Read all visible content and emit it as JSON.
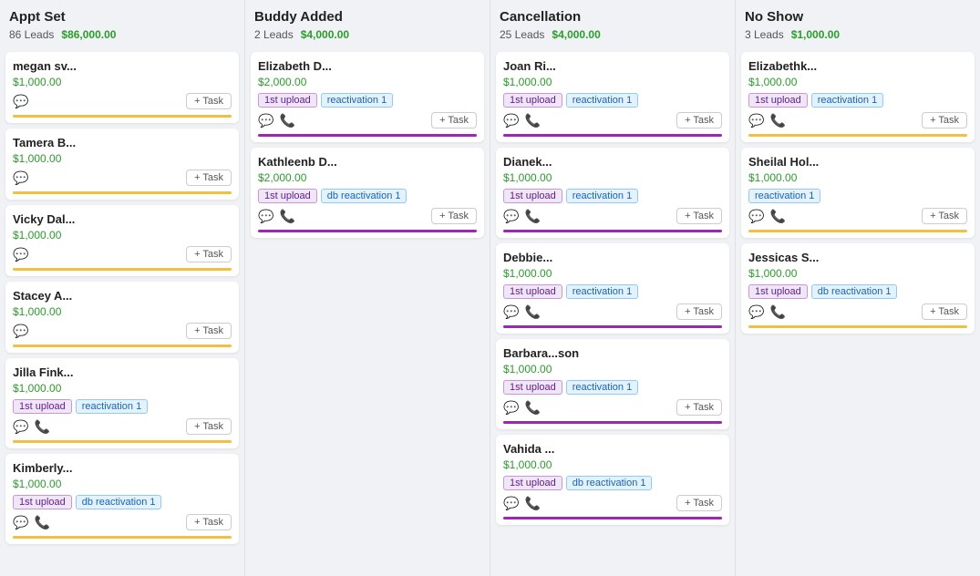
{
  "columns": [
    {
      "id": "appt-set",
      "title": "Appt Set",
      "leads": "86 Leads",
      "amount": "$86,000.00",
      "cards": [
        {
          "name": "megan sv...",
          "amount": "$1,000.00",
          "tags": [],
          "showPhone": false,
          "divider": "gold"
        },
        {
          "name": "Tamera B...",
          "amount": "$1,000.00",
          "tags": [],
          "showPhone": false,
          "divider": "gold"
        },
        {
          "name": "Vicky Dal...",
          "amount": "$1,000.00",
          "tags": [],
          "showPhone": false,
          "divider": "gold"
        },
        {
          "name": "Stacey A...",
          "amount": "$1,000.00",
          "tags": [],
          "showPhone": false,
          "divider": "gold"
        },
        {
          "name": "Jilla Fink...",
          "amount": "$1,000.00",
          "tags": [
            {
              "text": "1st upload",
              "type": "purple"
            },
            {
              "text": "reactivation 1",
              "type": "blue"
            }
          ],
          "showPhone": true,
          "divider": "gold"
        },
        {
          "name": "Kimberly...",
          "amount": "$1,000.00",
          "tags": [
            {
              "text": "1st upload",
              "type": "purple"
            },
            {
              "text": "db reactivation 1",
              "type": "blue"
            }
          ],
          "showPhone": true,
          "divider": "gold"
        }
      ]
    },
    {
      "id": "buddy-added",
      "title": "Buddy Added",
      "leads": "2 Leads",
      "amount": "$4,000.00",
      "cards": [
        {
          "name": "Elizabeth D...",
          "amount": "$2,000.00",
          "tags": [
            {
              "text": "1st upload",
              "type": "purple"
            },
            {
              "text": "reactivation 1",
              "type": "blue"
            }
          ],
          "showPhone": true,
          "divider": "purple"
        },
        {
          "name": "Kathleenb D...",
          "amount": "$2,000.00",
          "tags": [
            {
              "text": "1st upload",
              "type": "purple"
            },
            {
              "text": "db reactivation 1",
              "type": "blue"
            }
          ],
          "showPhone": true,
          "divider": "purple"
        }
      ]
    },
    {
      "id": "cancellation",
      "title": "Cancellation",
      "leads": "25 Leads",
      "amount": "$4,000.00",
      "cards": [
        {
          "name": "Joan Ri...",
          "amount": "$1,000.00",
          "tags": [
            {
              "text": "1st upload",
              "type": "purple"
            },
            {
              "text": "reactivation 1",
              "type": "blue"
            }
          ],
          "showPhone": true,
          "divider": "purple"
        },
        {
          "name": "Dianek...",
          "amount": "$1,000.00",
          "tags": [
            {
              "text": "1st upload",
              "type": "purple"
            },
            {
              "text": "reactivation 1",
              "type": "blue"
            }
          ],
          "showPhone": true,
          "divider": "purple"
        },
        {
          "name": "Debbie...",
          "amount": "$1,000.00",
          "tags": [
            {
              "text": "1st upload",
              "type": "purple"
            },
            {
              "text": "reactivation 1",
              "type": "blue"
            }
          ],
          "showPhone": true,
          "divider": "purple"
        },
        {
          "name": "Barbara...son",
          "amount": "$1,000.00",
          "tags": [
            {
              "text": "1st upload",
              "type": "purple"
            },
            {
              "text": "reactivation 1",
              "type": "blue"
            }
          ],
          "showPhone": true,
          "divider": "purple"
        },
        {
          "name": "Vahida ...",
          "amount": "$1,000.00",
          "tags": [
            {
              "text": "1st upload",
              "type": "purple"
            },
            {
              "text": "db reactivation 1",
              "type": "blue"
            }
          ],
          "showPhone": true,
          "divider": "purple"
        }
      ]
    },
    {
      "id": "no-show",
      "title": "No Show",
      "leads": "3 Leads",
      "amount": "$1,000.00",
      "cards": [
        {
          "name": "Elizabethk...",
          "amount": "$1,000.00",
          "tags": [
            {
              "text": "1st upload",
              "type": "purple"
            },
            {
              "text": "reactivation 1",
              "type": "blue"
            }
          ],
          "showPhone": true,
          "divider": "gold"
        },
        {
          "name": "Sheilal Hol...",
          "amount": "$1,000.00",
          "tags": [
            {
              "text": "reactivation 1",
              "type": "blue"
            }
          ],
          "showPhone": true,
          "divider": "gold"
        },
        {
          "name": "Jessicas S...",
          "amount": "$1,000.00",
          "tags": [
            {
              "text": "1st upload",
              "type": "purple"
            },
            {
              "text": "db reactivation 1",
              "type": "blue"
            }
          ],
          "showPhone": true,
          "divider": "gold"
        }
      ]
    }
  ],
  "buttons": {
    "addTask": "+ Task"
  }
}
